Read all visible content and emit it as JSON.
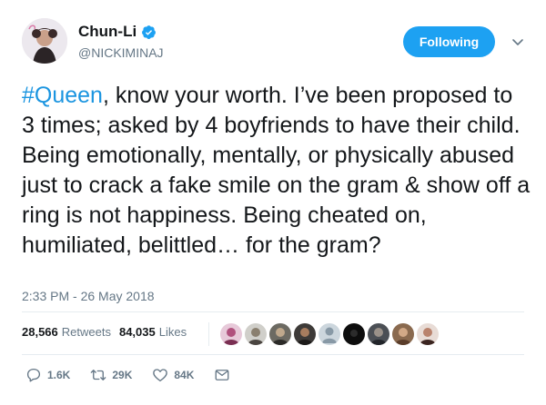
{
  "user": {
    "display_name": "Chun-Li",
    "handle": "@NICKIMINAJ",
    "verified": true
  },
  "follow_button": {
    "label": "Following"
  },
  "tweet": {
    "hashtag": "#Queen",
    "text_rest": ", know your worth. I’ve been proposed to 3 times; asked by 4 boyfriends to have their child. Being emotionally, mentally, or physically abused just to crack a fake smile on the gram & show off a ring is not happiness. Being cheated on, humiliated, belittled… for the gram?",
    "timestamp": "2:33 PM - 26 May 2018"
  },
  "stats": {
    "retweets_count": "28,566",
    "retweets_label": "Retweets",
    "likes_count": "84,035",
    "likes_label": "Likes"
  },
  "liker_avatars": [
    {
      "name": "avatar-1"
    },
    {
      "name": "avatar-2"
    },
    {
      "name": "avatar-3"
    },
    {
      "name": "avatar-4"
    },
    {
      "name": "avatar-5"
    },
    {
      "name": "avatar-6"
    },
    {
      "name": "avatar-7"
    },
    {
      "name": "avatar-8"
    },
    {
      "name": "avatar-9"
    }
  ],
  "actions": {
    "replies": "1.6K",
    "retweets": "29K",
    "likes": "84K"
  },
  "colors": {
    "accent": "#1da1f2",
    "hashtag": "#1b95e0",
    "muted": "#657786",
    "text": "#14171a"
  },
  "icons": {
    "verified": "verified-badge-icon",
    "caret": "chevron-down-icon",
    "reply": "reply-icon",
    "retweet": "retweet-icon",
    "like": "heart-icon",
    "dm": "envelope-icon"
  }
}
